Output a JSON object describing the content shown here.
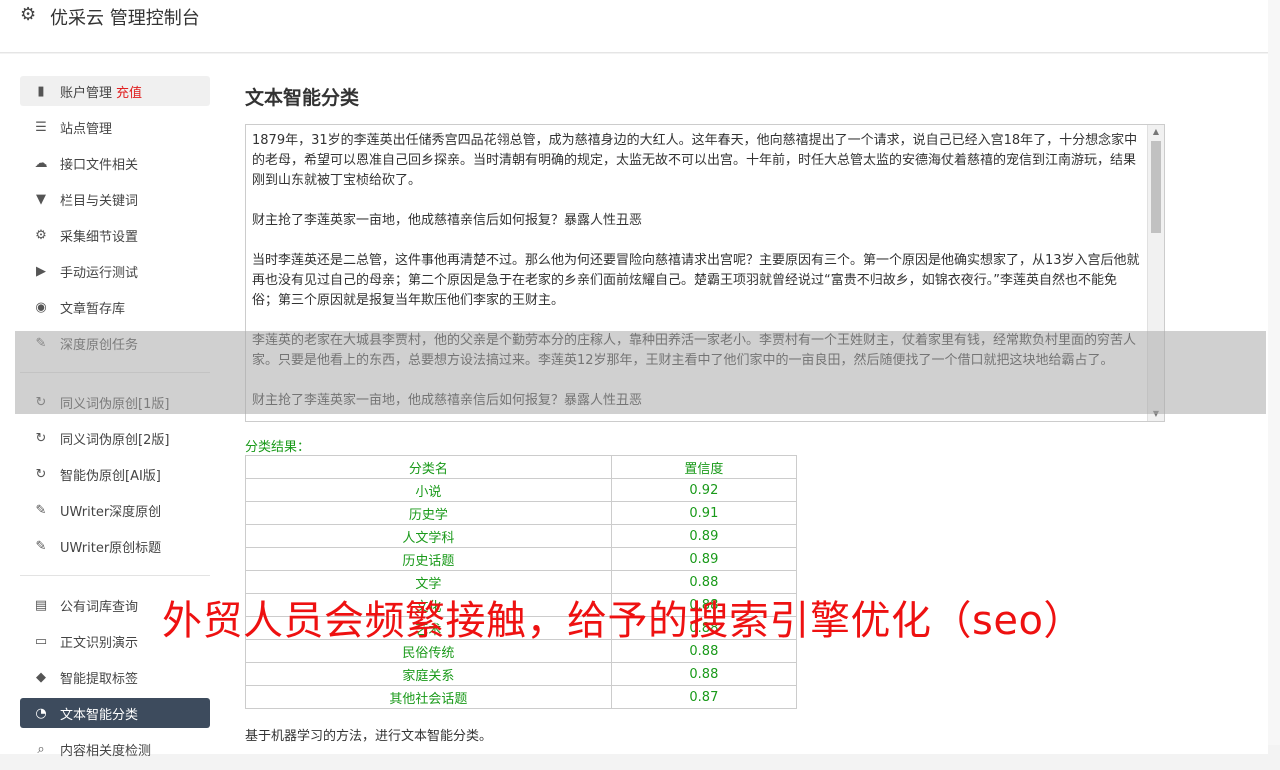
{
  "header": {
    "title": "优采云 管理控制台",
    "icon": "gear-icon"
  },
  "sidebar": {
    "groups": [
      [
        {
          "label": "账户管理",
          "badge": "充值",
          "icon": "bar-chart-icon"
        },
        {
          "label": "站点管理",
          "icon": "server-icon"
        },
        {
          "label": "接口文件相关",
          "icon": "cloud-upload-icon"
        },
        {
          "label": "栏目与关键词",
          "icon": "filter-icon"
        },
        {
          "label": "采集细节设置",
          "icon": "gears-icon"
        },
        {
          "label": "手动运行测试",
          "icon": "play-circle-icon"
        },
        {
          "label": "文章暂存库",
          "icon": "database-icon"
        },
        {
          "label": "深度原创任务",
          "icon": "edit-icon"
        }
      ],
      [
        {
          "label": "同义词伪原创[1版]",
          "icon": "refresh-icon"
        },
        {
          "label": "同义词伪原创[2版]",
          "icon": "refresh-icon"
        },
        {
          "label": "智能伪原创[AI版]",
          "icon": "refresh-icon"
        },
        {
          "label": "UWriter深度原创",
          "icon": "edit-icon"
        },
        {
          "label": "UWriter原创标题",
          "icon": "edit-icon"
        }
      ],
      [
        {
          "label": "公有词库查询",
          "icon": "book-icon"
        },
        {
          "label": "正文识别演示",
          "icon": "monitor-icon"
        },
        {
          "label": "智能提取标签",
          "icon": "tag-icon"
        },
        {
          "label": "文本智能分类",
          "icon": "pie-chart-icon"
        },
        {
          "label": "内容相关度检测",
          "icon": "search-icon"
        }
      ]
    ]
  },
  "content": {
    "title": "文本智能分类",
    "paragraphs": [
      "1879年，31岁的李莲英出任储秀宫四品花翎总管，成为慈禧身边的大红人。这年春天，他向慈禧提出了一个请求，说自己已经入宫18年了，十分想念家中的老母，希望可以恩准自己回乡探亲。当时清朝有明确的规定，太监无故不可以出宫。十年前，时任大总管太监的安德海仗着慈禧的宠信到江南游玩，结果刚到山东就被丁宝桢给砍了。",
      "财主抢了李莲英家一亩地，他成慈禧亲信后如何报复？暴露人性丑恶",
      "当时李莲英还是二总管，这件事他再清楚不过。那么他为何还要冒险向慈禧请求出宫呢？主要原因有三个。第一个原因是他确实想家了，从13岁入宫后他就再也没有见过自己的母亲；第二个原因是急于在老家的乡亲们面前炫耀自己。楚霸王项羽就曾经说过“富贵不归故乡，如锦衣夜行。”李莲英自然也不能免俗；第三个原因就是报复当年欺压他们李家的王财主。",
      "李莲英的老家在大城县李贾村，他的父亲是个勤劳本分的庄稼人，靠种田养活一家老小。李贾村有一个王姓财主，仗着家里有钱，经常欺负村里面的穷苦人家。只要是他看上的东西，总要想方设法搞过来。李莲英12岁那年，王财主看中了他们家中的一亩良田，然后随便找了一个借口就把这块地给霸占了。",
      "财主抢了李莲英家一亩地，他成慈禧亲信后如何报复？暴露人性丑恶"
    ],
    "result_label": "分类结果：",
    "table": {
      "headers": [
        "分类名",
        "置信度"
      ],
      "rows": [
        [
          "小说",
          "0.92"
        ],
        [
          "历史学",
          "0.91"
        ],
        [
          "人文学科",
          "0.89"
        ],
        [
          "历史话题",
          "0.89"
        ],
        [
          "文学",
          "0.88"
        ],
        [
          "文化",
          "0.88"
        ],
        [
          "艺术",
          "0.88"
        ],
        [
          "民俗传统",
          "0.88"
        ],
        [
          "家庭关系",
          "0.88"
        ],
        [
          "其他社会话题",
          "0.87"
        ]
      ]
    },
    "footnote": "基于机器学习的方法，进行文本智能分类。"
  },
  "watermark": "外贸人员会频繁接触，给予的搜索引擎优化（seo）"
}
